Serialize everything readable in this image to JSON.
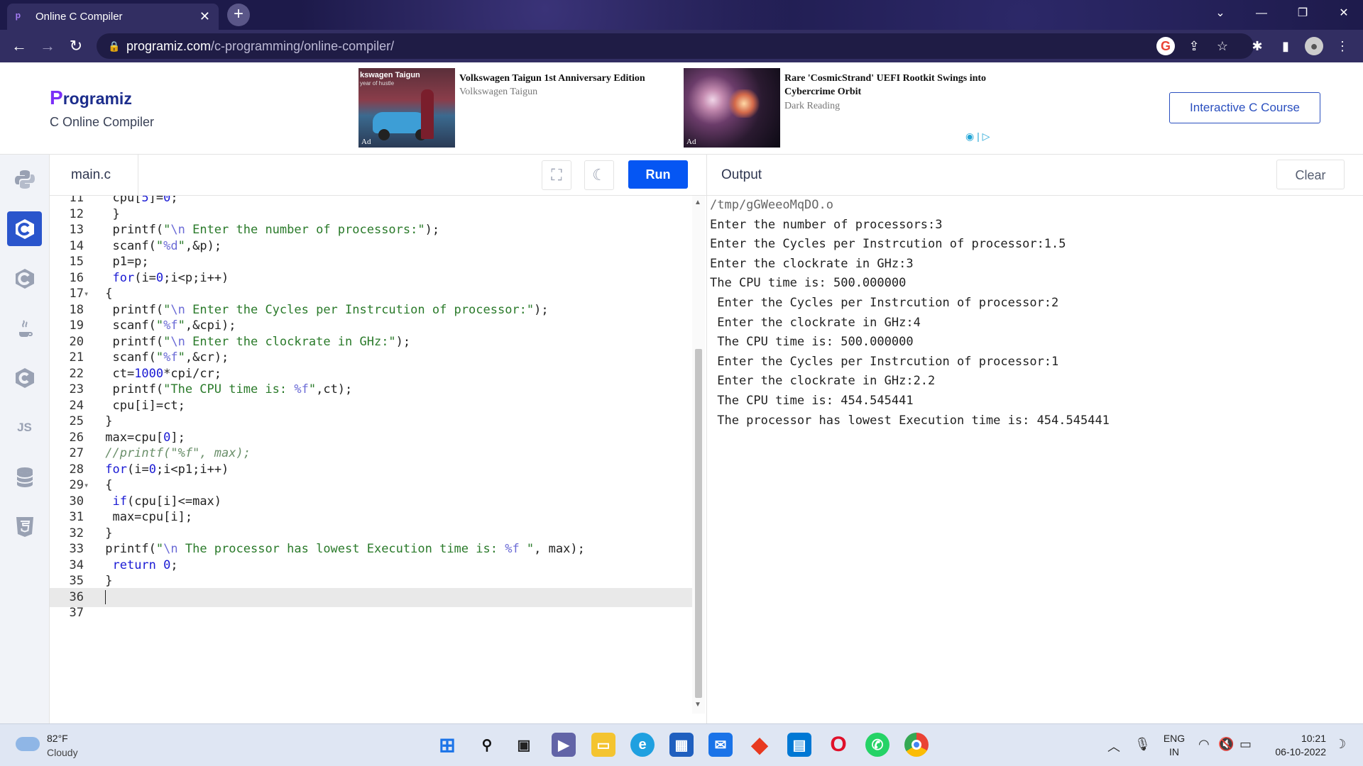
{
  "browser": {
    "tab_title": "Online C Compiler",
    "url_domain": "programiz.com",
    "url_path": "/c-programming/online-compiler/"
  },
  "header": {
    "logo_text": "rogramiz",
    "logo_mark": "P",
    "subtitle": "C Online Compiler",
    "course_button": "Interactive C Course",
    "ads": [
      {
        "thumb_text": "kswagen Taigun",
        "thumb_sub": "year of hustle",
        "title": "Volkswagen Taigun 1st Anniversary Edition",
        "source": "Volkswagen Taigun",
        "tag": "Ad"
      },
      {
        "title": "Rare 'CosmicStrand' UEFI Rootkit Swings into Cybercrime Orbit",
        "source": "Dark Reading",
        "tag": "Ad"
      }
    ]
  },
  "sidebar": {
    "items": [
      {
        "name": "python-icon",
        "active": false
      },
      {
        "name": "c-icon",
        "active": true
      },
      {
        "name": "cpp-icon",
        "active": false
      },
      {
        "name": "java-icon",
        "active": false
      },
      {
        "name": "csharp-icon",
        "active": false
      },
      {
        "name": "js-icon",
        "active": false,
        "label": "JS"
      },
      {
        "name": "sql-icon",
        "active": false
      },
      {
        "name": "html-icon",
        "active": false
      }
    ]
  },
  "editor": {
    "file_name": "main.c",
    "run_label": "Run",
    "lines": [
      {
        "n": "11",
        "html": "  cpu[5]=0;"
      },
      {
        "n": "12",
        "html": "  }"
      },
      {
        "n": "13",
        "html": "  printf(\"\\n Enter the number of processors:\");"
      },
      {
        "n": "14",
        "html": "  scanf(\"%d\",&p);"
      },
      {
        "n": "15",
        "html": "  p1=p;"
      },
      {
        "n": "16",
        "html": "  for(i=0;i<p;i++)"
      },
      {
        "n": "17",
        "html": " {",
        "fold": true
      },
      {
        "n": "18",
        "html": "  printf(\"\\n Enter the Cycles per Instrcution of processor:\");"
      },
      {
        "n": "19",
        "html": "  scanf(\"%f\",&cpi);"
      },
      {
        "n": "20",
        "html": "  printf(\"\\n Enter the clockrate in GHz:\");"
      },
      {
        "n": "21",
        "html": "  scanf(\"%f\",&cr);"
      },
      {
        "n": "22",
        "html": "  ct=1000*cpi/cr;"
      },
      {
        "n": "23",
        "html": "  printf(\"The CPU time is: %f\",ct);"
      },
      {
        "n": "24",
        "html": "  cpu[i]=ct;"
      },
      {
        "n": "25",
        "html": " }"
      },
      {
        "n": "26",
        "html": " max=cpu[0];"
      },
      {
        "n": "27",
        "html": " //printf(\"%f\", max);"
      },
      {
        "n": "28",
        "html": " for(i=0;i<p1;i++)"
      },
      {
        "n": "29",
        "html": " {",
        "fold": true
      },
      {
        "n": "30",
        "html": "  if(cpu[i]<=max)"
      },
      {
        "n": "31",
        "html": "  max=cpu[i];"
      },
      {
        "n": "32",
        "html": " }"
      },
      {
        "n": "33",
        "html": " printf(\"\\n The processor has lowest Execution time is: %f \", max);"
      },
      {
        "n": "34",
        "html": "  return 0;"
      },
      {
        "n": "35",
        "html": " }"
      },
      {
        "n": "36",
        "html": " ",
        "current": true
      },
      {
        "n": "37",
        "html": ""
      }
    ]
  },
  "output": {
    "title": "Output",
    "clear_label": "Clear",
    "lines": [
      "/tmp/gGWeeoMqDO.o",
      "Enter the number of processors:3",
      "Enter the Cycles per Instrcution of processor:1.5",
      "Enter the clockrate in GHz:3",
      "The CPU time is: 500.000000",
      " Enter the Cycles per Instrcution of processor:2",
      " Enter the clockrate in GHz:4",
      " The CPU time is: 500.000000",
      " Enter the Cycles per Instrcution of processor:1",
      " Enter the clockrate in GHz:2.2",
      " The CPU time is: 454.545441",
      " The processor has lowest Execution time is: 454.545441 "
    ]
  },
  "taskbar": {
    "temperature": "82°F",
    "condition": "Cloudy",
    "lang_top": "ENG",
    "lang_bottom": "IN",
    "time": "10:21",
    "date": "06-10-2022"
  }
}
